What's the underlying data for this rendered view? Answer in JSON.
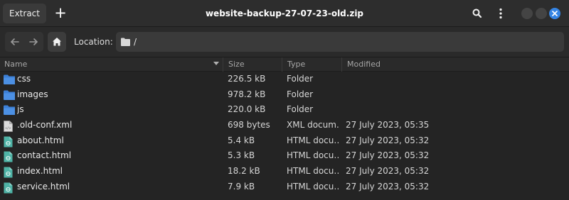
{
  "header": {
    "extract_label": "Extract",
    "add_label": "+",
    "title": "website-backup-27-07-23-old.zip",
    "icons": [
      "search-icon",
      "menu-icon",
      "minimize-icon",
      "maximize-icon",
      "close-icon"
    ]
  },
  "toolbar": {
    "location_label": "Location:",
    "path": "/"
  },
  "columns": {
    "name": "Name",
    "size": "Size",
    "type": "Type",
    "modified": "Modified"
  },
  "files": [
    {
      "name": "css",
      "size": "226.5 kB",
      "type": "Folder",
      "modified": "",
      "icon": "folder-icon"
    },
    {
      "name": "images",
      "size": "978.2 kB",
      "type": "Folder",
      "modified": "",
      "icon": "folder-icon"
    },
    {
      "name": "js",
      "size": "220.0 kB",
      "type": "Folder",
      "modified": "",
      "icon": "folder-icon"
    },
    {
      "name": ".old-conf.xml",
      "size": "698 bytes",
      "type": "XML docum…",
      "modified": "27 July 2023, 05:35",
      "icon": "xml-file-icon"
    },
    {
      "name": "about.html",
      "size": "5.4 kB",
      "type": "HTML docu…",
      "modified": "27 July 2023, 05:32",
      "icon": "html-file-icon"
    },
    {
      "name": "contact.html",
      "size": "5.3 kB",
      "type": "HTML docu…",
      "modified": "27 July 2023, 05:32",
      "icon": "html-file-icon"
    },
    {
      "name": "index.html",
      "size": "18.2 kB",
      "type": "HTML docu…",
      "modified": "27 July 2023, 05:32",
      "icon": "html-file-icon"
    },
    {
      "name": "service.html",
      "size": "7.9 kB",
      "type": "HTML docu…",
      "modified": "27 July 2023, 05:32",
      "icon": "html-file-icon"
    }
  ],
  "colors": {
    "accent": "#3584e4",
    "folder": "#3c7fd6",
    "html_file": "#4fb3a6",
    "xml_file": "#9a9a9a"
  }
}
